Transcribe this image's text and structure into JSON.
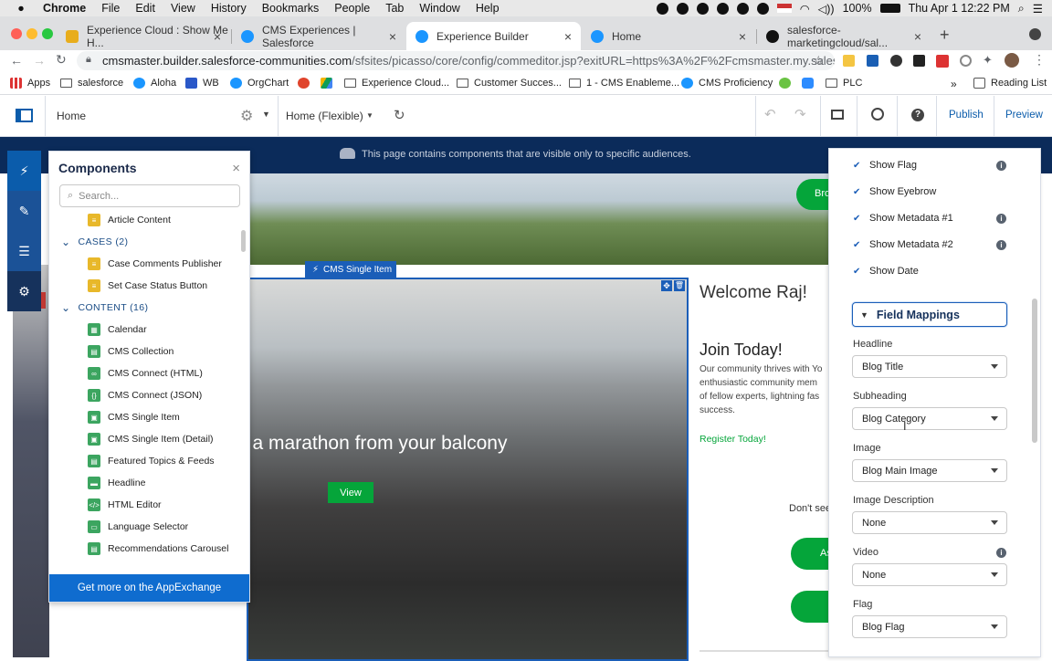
{
  "menubar": {
    "app": "Chrome",
    "items": [
      "File",
      "Edit",
      "View",
      "History",
      "Bookmarks",
      "People",
      "Tab",
      "Window",
      "Help"
    ],
    "battery": "100%",
    "datetime": "Thu Apr 1  12:22 PM"
  },
  "tabs": [
    {
      "label": "Experience Cloud : Show Me H...",
      "color": "#e8ad1c"
    },
    {
      "label": "CMS Experiences | Salesforce",
      "color": "#1b96ff"
    },
    {
      "label": "Experience Builder",
      "color": "#1b96ff"
    },
    {
      "label": "Home",
      "color": "#1b96ff"
    },
    {
      "label": "salesforce-marketingcloud/sal...",
      "color": "#111111"
    }
  ],
  "url": {
    "host": "cmsmaster.builder.salesforce-communities.com",
    "path": "/sfsites/picasso/core/config/commeditor.jsp?exitURL=https%3A%2F%2Fcmsmaster.my.salesfo..."
  },
  "bookmarks": [
    "Apps",
    "salesforce",
    "Aloha",
    "WB",
    "OrgChart",
    "Experience Cloud...",
    "Customer Succes...",
    "1 - CMS Enableme...",
    "CMS Proficiency",
    "PLC",
    "Reading List"
  ],
  "builder": {
    "page": "Home",
    "layout": "Home (Flexible)",
    "publish": "Publish",
    "preview": "Preview"
  },
  "canvas": {
    "audience_notice": "This page contains components that are visible only to specific audiences.",
    "cms_single_item_tag": "CMS Single Item",
    "hero_text": "n a marathon from your balcony",
    "view_button": "View",
    "top_button_partial": "Bro",
    "welcome": "Welcome Raj!",
    "join": "Join Today!",
    "join_body_lines": [
      "Our community thrives with Yo",
      "enthusiastic community mem",
      "of fellow experts, lightning fas",
      "success."
    ],
    "register": "Register Today!",
    "dont_see": "Don't see",
    "ask_partial": "As"
  },
  "components_panel": {
    "title": "Components",
    "search_placeholder": "Search...",
    "more": "Get more on the AppExchange",
    "rows": [
      {
        "type": "item",
        "label": "Article Content",
        "color": "#e8b82a",
        "glyph": "≡"
      },
      {
        "type": "group",
        "label": "CASES (2)"
      },
      {
        "type": "item",
        "label": "Case Comments Publisher",
        "color": "#e8b82a",
        "glyph": "≡"
      },
      {
        "type": "item",
        "label": "Set Case Status Button",
        "color": "#e8b82a",
        "glyph": "≡"
      },
      {
        "type": "group",
        "label": "CONTENT (16)"
      },
      {
        "type": "item",
        "label": "Calendar",
        "color": "#3ca560",
        "glyph": "▦"
      },
      {
        "type": "item",
        "label": "CMS Collection",
        "color": "#3ca560",
        "glyph": "▤"
      },
      {
        "type": "item",
        "label": "CMS Connect (HTML)",
        "color": "#3ca560",
        "glyph": "∞"
      },
      {
        "type": "item",
        "label": "CMS Connect (JSON)",
        "color": "#3ca560",
        "glyph": "{}"
      },
      {
        "type": "item",
        "label": "CMS Single Item",
        "color": "#3ca560",
        "glyph": "▣"
      },
      {
        "type": "item",
        "label": "CMS Single Item (Detail)",
        "color": "#3ca560",
        "glyph": "▣"
      },
      {
        "type": "item",
        "label": "Featured Topics & Feeds",
        "color": "#3ca560",
        "glyph": "▤"
      },
      {
        "type": "item",
        "label": "Headline",
        "color": "#3ca560",
        "glyph": "▬"
      },
      {
        "type": "item",
        "label": "HTML Editor",
        "color": "#3ca560",
        "glyph": "</>"
      },
      {
        "type": "item",
        "label": "Language Selector",
        "color": "#3ca560",
        "glyph": "▭"
      },
      {
        "type": "item",
        "label": "Recommendations Carousel",
        "color": "#3ca560",
        "glyph": "▤"
      }
    ]
  },
  "properties": {
    "checks": [
      {
        "label": "Show Flag",
        "info": true
      },
      {
        "label": "Show Eyebrow",
        "info": false
      },
      {
        "label": "Show Metadata #1",
        "info": true
      },
      {
        "label": "Show Metadata #2",
        "info": true
      },
      {
        "label": "Show Date",
        "info": false
      }
    ],
    "section": "Field Mappings",
    "fields": [
      {
        "label": "Headline",
        "value": "Blog Title",
        "info": false
      },
      {
        "label": "Subheading",
        "value": "Blog Category",
        "info": false
      },
      {
        "label": "Image",
        "value": "Blog Main Image",
        "info": false
      },
      {
        "label": "Image Description",
        "value": "None",
        "info": false
      },
      {
        "label": "Video",
        "value": "None",
        "info": true
      },
      {
        "label": "Flag",
        "value": "Blog Flag",
        "info": false
      }
    ]
  }
}
